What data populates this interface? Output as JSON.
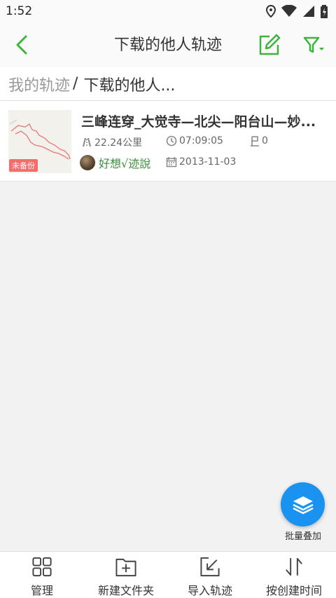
{
  "status_bar": {
    "time": "1:52"
  },
  "app_bar": {
    "title": "下载的他人轨迹"
  },
  "breadcrumb": {
    "root": "我的轨迹",
    "separator": "/",
    "current": "下载的他人..."
  },
  "tracks": [
    {
      "title": "三峰连穿_大觉寺—北尖—阳台山—妙...",
      "distance": "22.24公里",
      "duration": "07:09:05",
      "waypoints": "0",
      "author": "好想√迹說",
      "date": "2013-11-03",
      "backup_badge": "未备份"
    }
  ],
  "fab": {
    "label": "批量叠加"
  },
  "bottom_nav": [
    {
      "label": "管理",
      "icon": "grid-icon"
    },
    {
      "label": "新建文件夹",
      "icon": "new-folder-icon"
    },
    {
      "label": "导入轨迹",
      "icon": "import-icon"
    },
    {
      "label": "按创建时间",
      "icon": "sort-icon"
    }
  ],
  "colors": {
    "accent": "#3bb53b",
    "fab": "#1a93f0",
    "badge": "#f56c6c",
    "author": "#3a8f3a"
  }
}
